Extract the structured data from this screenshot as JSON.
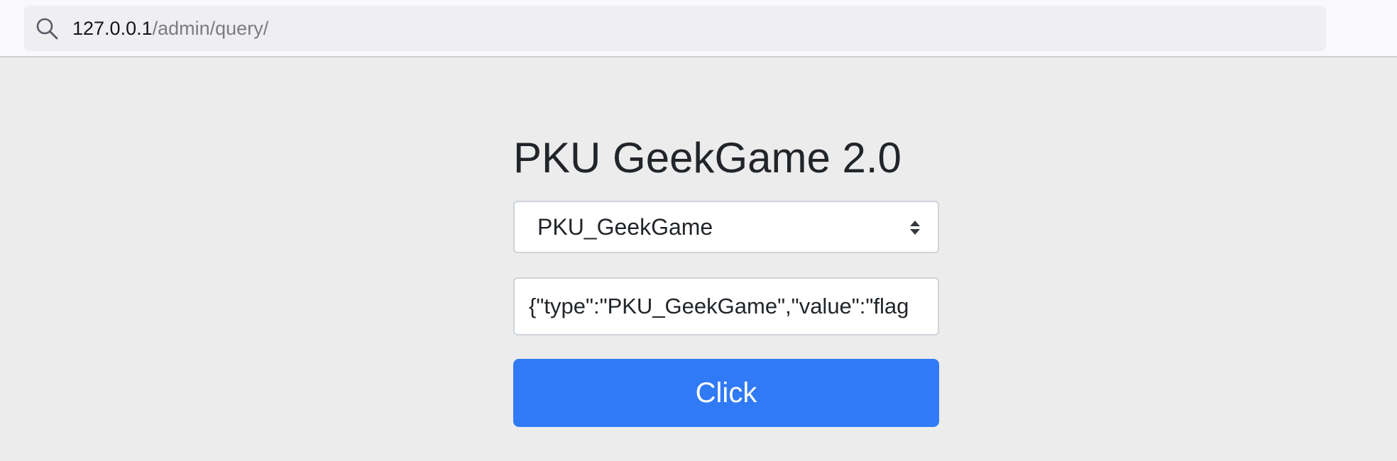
{
  "browser": {
    "url_host": "127.0.0.1",
    "url_path": "/admin/query/",
    "search_icon": "search-icon"
  },
  "form": {
    "title": "PKU GeekGame 2.0",
    "select": {
      "selected_value": "PKU_GeekGame",
      "arrow_icon": "select-arrows-icon"
    },
    "json_input": {
      "value": "{\"type\":\"PKU_GeekGame\",\"value\":\"flag"
    },
    "submit_label": "Click",
    "accent_color": "#307af5"
  }
}
